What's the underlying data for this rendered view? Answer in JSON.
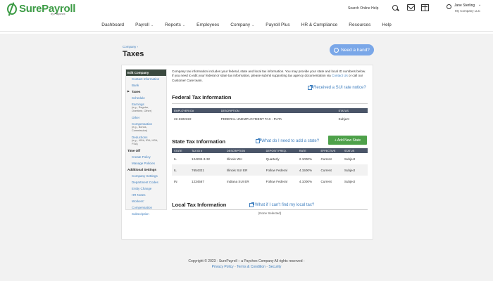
{
  "header": {
    "logo_text": "SurePayroll",
    "logo_sub": "by Paychex",
    "search_placeholder": "Search Online Help",
    "user_name": "Jane Sterling",
    "user_company": "My Company LLC"
  },
  "nav": {
    "items": [
      {
        "label": "Dashboard",
        "dropdown": false
      },
      {
        "label": "Payroll",
        "dropdown": true
      },
      {
        "label": "Reports",
        "dropdown": true
      },
      {
        "label": "Employees",
        "dropdown": false
      },
      {
        "label": "Company",
        "dropdown": true
      },
      {
        "label": "Payroll Plus",
        "dropdown": false
      },
      {
        "label": "HR & Compliance",
        "dropdown": false
      },
      {
        "label": "Resources",
        "dropdown": false
      },
      {
        "label": "Help",
        "dropdown": false
      }
    ]
  },
  "page": {
    "breadcrumb": "Company ›",
    "title": "Taxes",
    "help_button": "Need a hand?"
  },
  "sidebar": {
    "edit_company": "Edit Company",
    "items": [
      {
        "label": "Contact Information"
      },
      {
        "label": "Bank"
      },
      {
        "label": "Taxes",
        "active": true
      },
      {
        "label": "Schedule"
      },
      {
        "label": "Earnings",
        "note": "(e.g., Regular, Overtime, Other)"
      },
      {
        "label": "Other Compensation",
        "note": "(e.g., Bonus, Commission)"
      },
      {
        "label": "Deductions",
        "note": "(e.g., 401k, IRA, HSA, FSA)"
      }
    ],
    "time_off": "Time Off",
    "time_off_items": [
      "Create Policy",
      "Manage Policies"
    ],
    "additional": "Additional Settings",
    "additional_items": [
      "Company Settings",
      "Department Codes",
      "Entity Change",
      "HR Notes",
      "Workers' Compensation",
      "Subscription"
    ]
  },
  "intro": {
    "text1": "Company tax information includes your federal, state and local tax information. You may provide your state and local ID numbers below. If you need to edit your federal or state tax information, please submit supporting tax agency documentation via ",
    "contact_link": "Contact Us",
    "text2": " or call our Customer Care team.",
    "sui_link": "Received a SUI rate notice?"
  },
  "federal": {
    "title": "Federal Tax Information",
    "columns": [
      "EMPLOYER ID#",
      "DESCRIPTION",
      "STATUS"
    ],
    "rows": [
      [
        "22-2222222",
        "FEDERAL UNEMPLOYMENT TAX - FUTA",
        "Subject"
      ]
    ]
  },
  "state": {
    "title": "State Tax Information",
    "help_link": "What do I need to add a state?",
    "add_button": "+ Add New State",
    "columns": [
      "STATE",
      "TAX ID #",
      "DESCRIPTION",
      "DEPOSIT FREQ.",
      "RATE",
      "EFFECTIVE",
      "STATUS"
    ],
    "rows": [
      [
        "IL",
        "124234-3-32",
        "Illinois WH",
        "Quarterly",
        "2.1000%",
        "Current",
        "Subject"
      ],
      [
        "IL",
        "7654321",
        "Illinois SUI ER",
        "Follow Federal",
        "4.1500%",
        "Current",
        "Subject"
      ],
      [
        "IN",
        "1234567",
        "Indiana SUI ER",
        "Follow Federal",
        "4.1000%",
        "Current",
        "Subject"
      ]
    ]
  },
  "local": {
    "title": "Local Tax Information",
    "help_link": "What if I can't find my local tax?",
    "empty": "(None Selected)"
  },
  "footer": {
    "copyright": "Copyright © 2023 - SurePayroll – a Paychex Company All rights reserved -",
    "links": [
      "Privacy Policy",
      "Terms & Condition",
      "Security"
    ]
  }
}
